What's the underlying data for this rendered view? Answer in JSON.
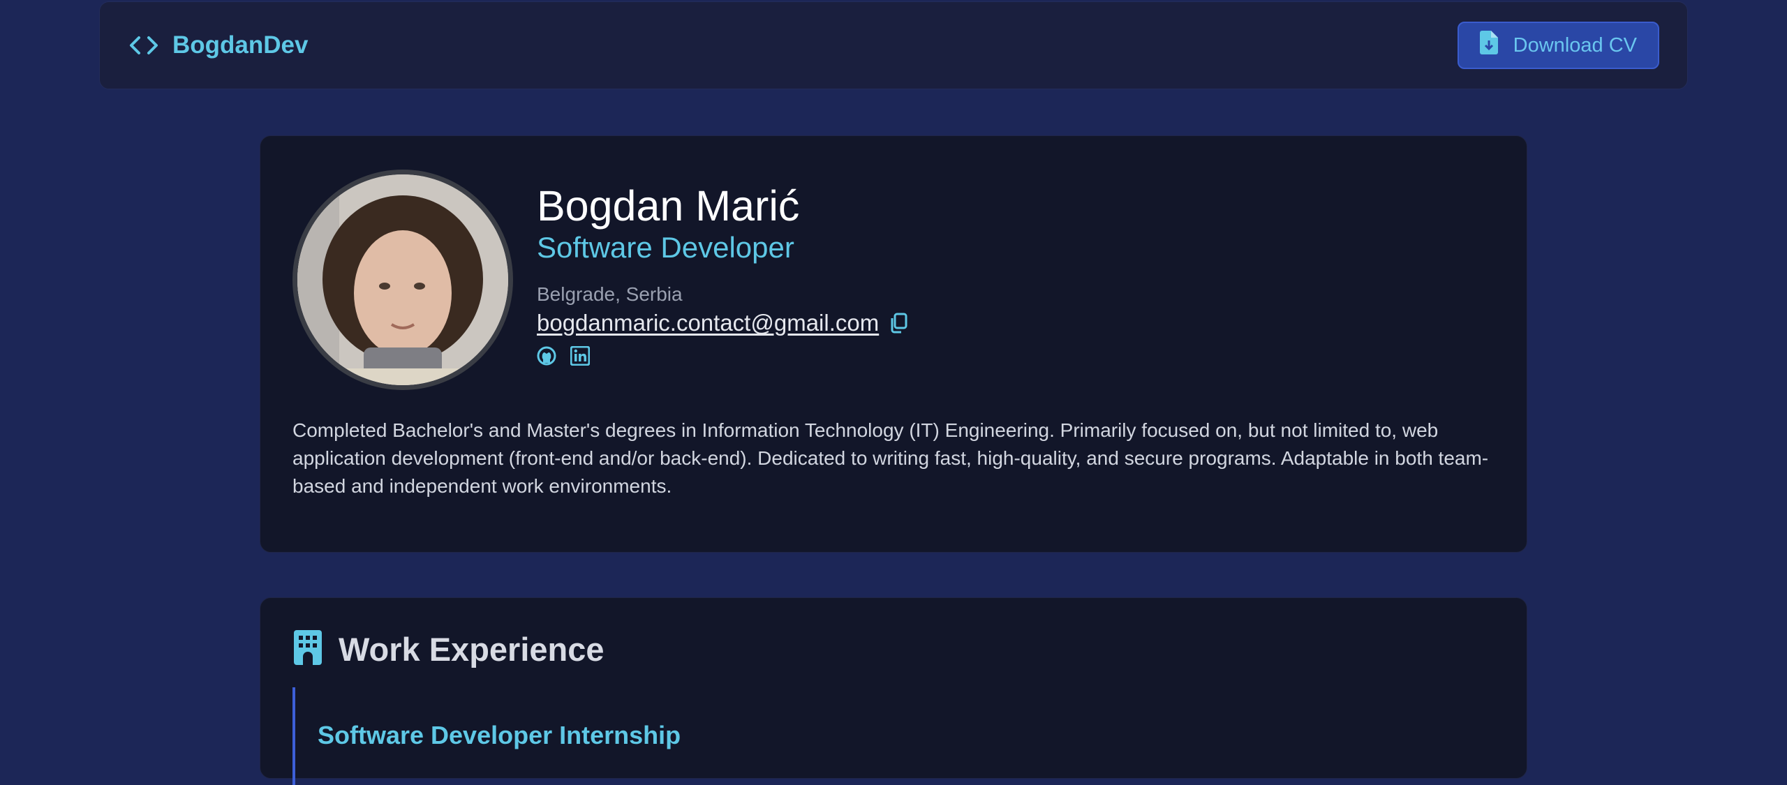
{
  "header": {
    "brand": "BogdanDev",
    "download_label": "Download CV"
  },
  "profile": {
    "name": "Bogdan Marić",
    "role": "Software Developer",
    "location": "Belgrade, Serbia",
    "email": "bogdanmaric.contact@gmail.com",
    "bio": "Completed Bachelor's and Master's degrees in Information Technology (IT) Engineering. Primarily focused on, but not limited to, web application development (front-end and/or back-end). Dedicated to writing fast, high-quality, and secure programs. Adaptable in both team-based and independent work environments."
  },
  "work": {
    "title": "Work Experience",
    "jobs": [
      {
        "title": "Software Developer Internship"
      }
    ]
  },
  "icons": {
    "brand": "code-icon",
    "download": "file-download-icon",
    "copy": "copy-icon",
    "github": "github-icon",
    "linkedin": "linkedin-icon",
    "work": "building-icon"
  },
  "colors": {
    "background": "#1c2657",
    "card": "#121629",
    "accent": "#5ec8e6",
    "button": "#2a47a6"
  }
}
